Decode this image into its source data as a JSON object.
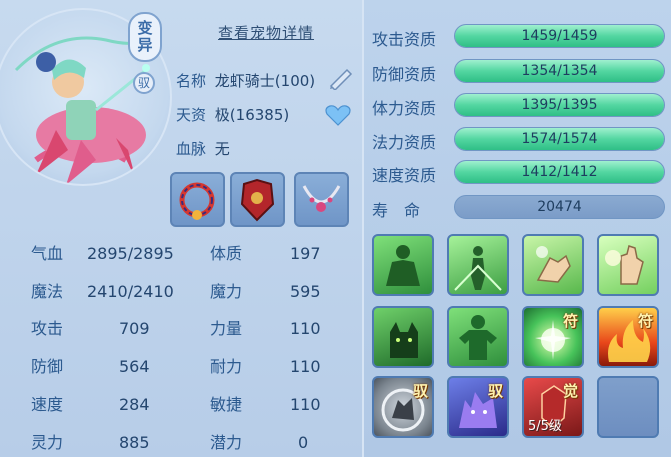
{
  "header": {
    "detail_link": "查看宠物详情",
    "mutate_badge_top": "变",
    "mutate_badge_bottom": "异",
    "ride_badge": "驭"
  },
  "pet": {
    "name_label": "名称",
    "name_value": "龙虾骑士(100)",
    "aptitude_label": "天资",
    "aptitude_value": "极(16385)",
    "blood_label": "血脉",
    "blood_value": "无"
  },
  "equipment": [
    "collar-icon",
    "armor-icon",
    "necklace-icon"
  ],
  "stats_left": [
    {
      "label": "气血",
      "value": "2895/2895"
    },
    {
      "label": "魔法",
      "value": "2410/2410"
    },
    {
      "label": "攻击",
      "value": "709"
    },
    {
      "label": "防御",
      "value": "564"
    },
    {
      "label": "速度",
      "value": "284"
    },
    {
      "label": "灵力",
      "value": "885"
    }
  ],
  "stats_right": [
    {
      "label": "体质",
      "value": "197"
    },
    {
      "label": "魔力",
      "value": "595"
    },
    {
      "label": "力量",
      "value": "110"
    },
    {
      "label": "耐力",
      "value": "110"
    },
    {
      "label": "敏捷",
      "value": "110"
    },
    {
      "label": "潜力",
      "value": "0"
    }
  ],
  "aptitudes": [
    {
      "label": "攻击资质",
      "value": "1459/1459",
      "fill": 1.0
    },
    {
      "label": "防御资质",
      "value": "1354/1354",
      "fill": 1.0
    },
    {
      "label": "体力资质",
      "value": "1395/1395",
      "fill": 1.0
    },
    {
      "label": "法力资质",
      "value": "1574/1574",
      "fill": 1.0
    },
    {
      "label": "速度资质",
      "value": "1412/1412",
      "fill": 1.0
    }
  ],
  "life": {
    "label": "寿　命",
    "value": "20474"
  },
  "skills": {
    "tag_fu": "符",
    "tag_yu": "驭",
    "tag_jue": "觉",
    "level_text": "5/5级",
    "names": [
      "strength-skill-icon",
      "shadow-figure-skill-icon",
      "hand-skill-icon",
      "glow-hand-skill-icon",
      "cat-skill-icon",
      "muscle-skill-icon",
      "orb-skill-icon",
      "fire-skill-icon",
      "wolf-grey-skill-icon",
      "wolf-purple-skill-icon",
      "awaken-skill-icon",
      "empty-skill-slot"
    ]
  },
  "colors": {
    "bar_green": "#53d6a1",
    "panel_blue": "#b9cfe9",
    "label_blue": "#2c5a8f"
  }
}
